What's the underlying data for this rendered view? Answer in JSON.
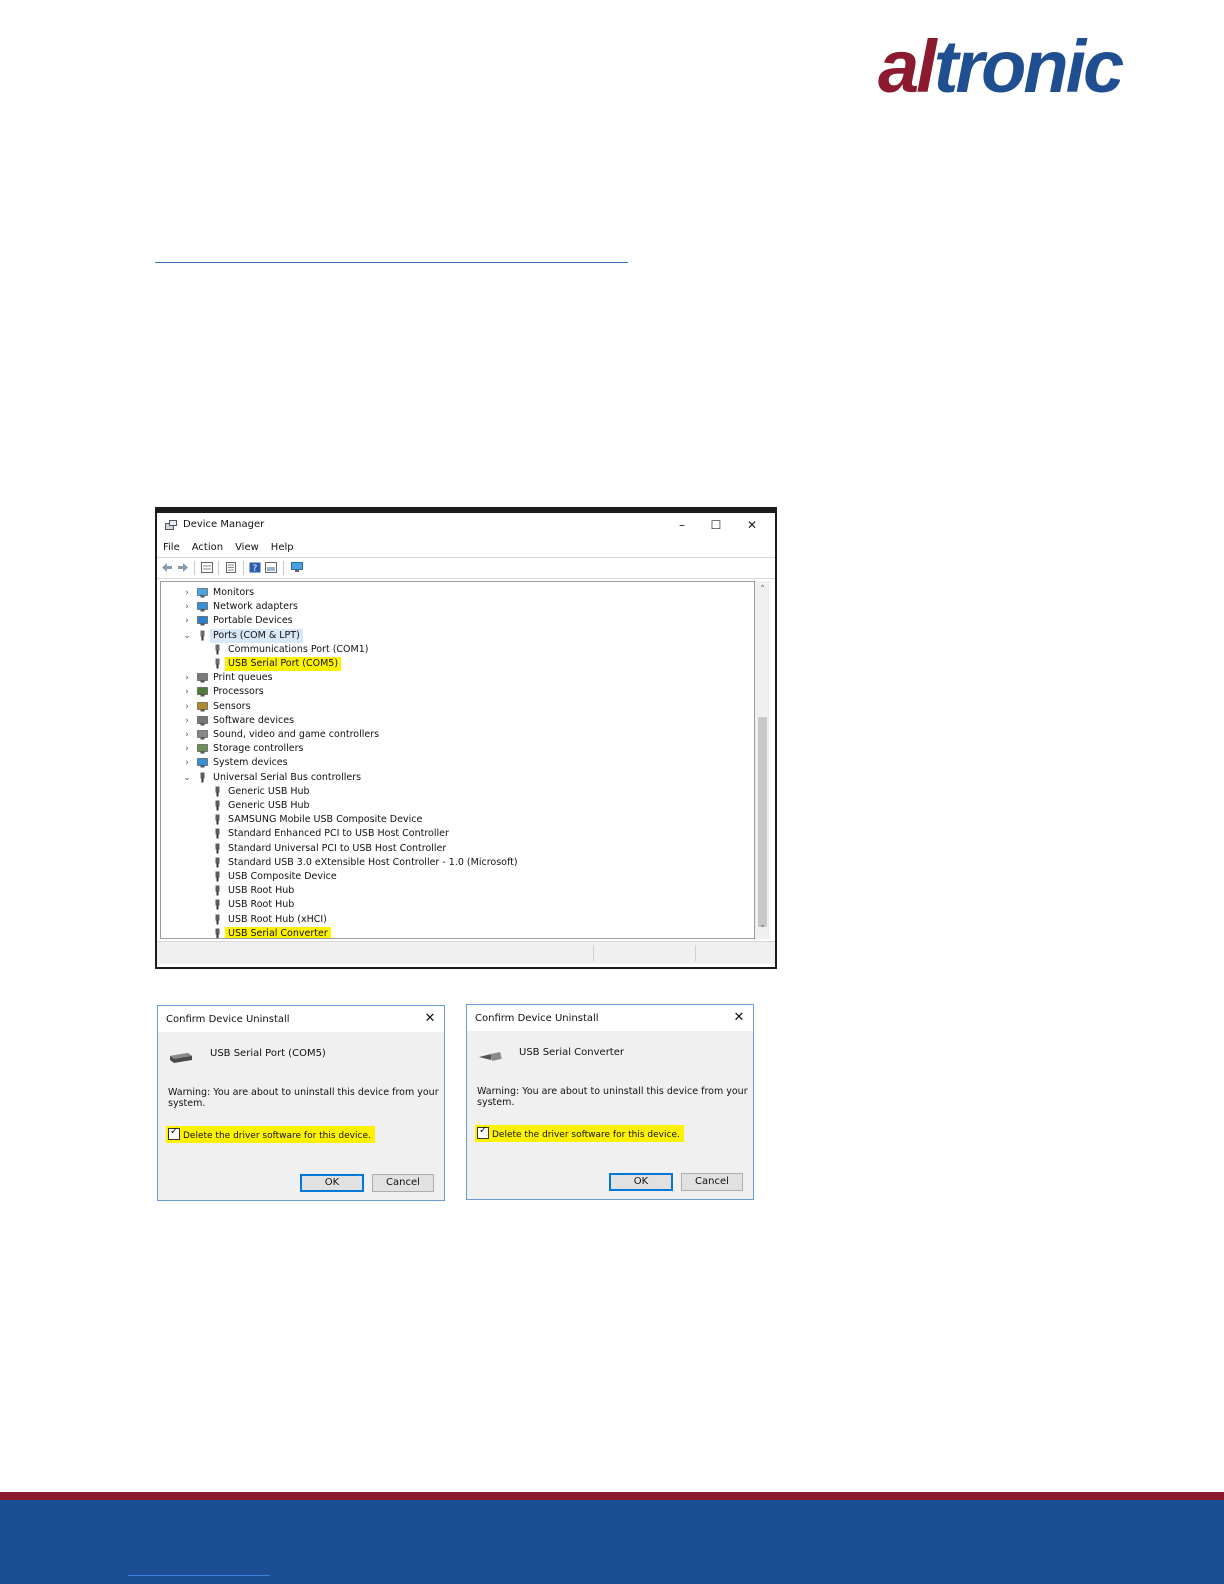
{
  "logo": {
    "part1": "al",
    "part2": "tronic",
    "colors": {
      "red": "#8b1a2f",
      "blue": "#1f4f91"
    }
  },
  "device_manager": {
    "title": "Device Manager",
    "window_buttons": {
      "minimize": "–",
      "maximize": "☐",
      "close": "✕"
    },
    "menu": [
      "File",
      "Action",
      "View",
      "Help"
    ],
    "tree": [
      {
        "label": "Monitors",
        "level": 0,
        "expander": "›",
        "icon": "monitor-icon"
      },
      {
        "label": "Network adapters",
        "level": 0,
        "expander": "›",
        "icon": "network-adapter-icon"
      },
      {
        "label": "Portable Devices",
        "level": 0,
        "expander": "›",
        "icon": "portable-device-icon"
      },
      {
        "label": "Ports (COM & LPT)",
        "level": 0,
        "expander": "⌄",
        "icon": "port-icon",
        "selected": true
      },
      {
        "label": "Communications Port (COM1)",
        "level": 1,
        "icon": "port-icon"
      },
      {
        "label": "USB Serial Port (COM5)",
        "level": 1,
        "icon": "port-icon",
        "highlighted": true
      },
      {
        "label": "Print queues",
        "level": 0,
        "expander": "›",
        "icon": "printer-icon"
      },
      {
        "label": "Processors",
        "level": 0,
        "expander": "›",
        "icon": "processor-icon"
      },
      {
        "label": "Sensors",
        "level": 0,
        "expander": "›",
        "icon": "sensor-icon"
      },
      {
        "label": "Software devices",
        "level": 0,
        "expander": "›",
        "icon": "software-device-icon"
      },
      {
        "label": "Sound, video and game controllers",
        "level": 0,
        "expander": "›",
        "icon": "speaker-icon"
      },
      {
        "label": "Storage controllers",
        "level": 0,
        "expander": "›",
        "icon": "storage-icon"
      },
      {
        "label": "System devices",
        "level": 0,
        "expander": "›",
        "icon": "system-device-icon"
      },
      {
        "label": "Universal Serial Bus controllers",
        "level": 0,
        "expander": "⌄",
        "icon": "usb-icon"
      },
      {
        "label": "Generic USB Hub",
        "level": 1,
        "icon": "usb-icon"
      },
      {
        "label": "Generic USB Hub",
        "level": 1,
        "icon": "usb-icon"
      },
      {
        "label": "SAMSUNG Mobile USB Composite Device",
        "level": 1,
        "icon": "usb-icon"
      },
      {
        "label": "Standard Enhanced PCI to USB Host Controller",
        "level": 1,
        "icon": "usb-icon"
      },
      {
        "label": "Standard Universal PCI to USB Host Controller",
        "level": 1,
        "icon": "usb-icon"
      },
      {
        "label": "Standard USB 3.0 eXtensible Host Controller - 1.0 (Microsoft)",
        "level": 1,
        "icon": "usb-icon"
      },
      {
        "label": "USB Composite Device",
        "level": 1,
        "icon": "usb-icon"
      },
      {
        "label": "USB Root Hub",
        "level": 1,
        "icon": "usb-icon"
      },
      {
        "label": "USB Root Hub",
        "level": 1,
        "icon": "usb-icon"
      },
      {
        "label": "USB Root Hub (xHCI)",
        "level": 1,
        "icon": "usb-icon"
      },
      {
        "label": "USB Serial Converter",
        "level": 1,
        "icon": "usb-icon",
        "highlighted": true
      }
    ],
    "scroll_arrows": {
      "up": "˄",
      "down": "˅"
    }
  },
  "dialogs": [
    {
      "title": "Confirm Device Uninstall",
      "close": "✕",
      "device": "USB Serial Port (COM5)",
      "warning": "Warning: You are about to uninstall this device from your system.",
      "checkbox_label": "Delete the driver software for this device.",
      "checkmark": "✓",
      "ok": "OK",
      "cancel": "Cancel"
    },
    {
      "title": "Confirm Device Uninstall",
      "close": "✕",
      "device": "USB Serial Converter",
      "warning": "Warning: You are about to uninstall this device from your system.",
      "checkbox_label": "Delete the driver software for this device.",
      "checkmark": "✓",
      "ok": "OK",
      "cancel": "Cancel"
    }
  ],
  "colors": {
    "highlight": "#fff200",
    "footer_red": "#8b1a2f",
    "footer_blue": "#1c4e94"
  }
}
